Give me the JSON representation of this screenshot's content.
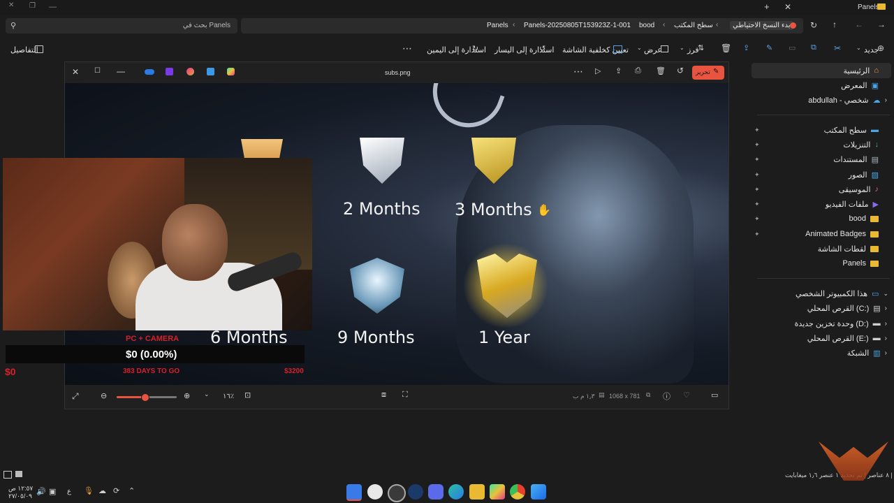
{
  "titlebar": {
    "app_label": "Panels"
  },
  "address": {
    "search_placeholder": "بحث في Panels",
    "breadcrumbs": [
      "Panels",
      "Panels-20250805T153923Z-1-001",
      "bood",
      "سطح المكتب",
      "بدء النسخ الاحتياطي"
    ]
  },
  "command_bar": {
    "details": "التفاصيل",
    "new": "جديد",
    "sort": "فرز",
    "view": "عرض",
    "set_wallpaper": "تعيين كخلفية الشاشة",
    "rotate_left": "استدارة إلى اليسار",
    "rotate_right": "استدارة إلى اليمين"
  },
  "sidebar": {
    "home": "الرئيسية",
    "gallery": "المعرض",
    "onedrive": "abdullah - شخصي",
    "pinned": [
      "سطح المكتب",
      "التنزيلات",
      "المستندات",
      "الصور",
      "الموسيقى",
      "ملفات الفيديو",
      "bood",
      "Animated Badges",
      "لقطات الشاشة",
      "Panels"
    ],
    "this_pc": "هذا الكمبيوتر الشخصي",
    "drives": [
      "القرص المحلي (C:)",
      "وحدة تخزين جديدة (D:)",
      "القرص المحلي (E:)"
    ],
    "network": "الشبكة"
  },
  "viewer": {
    "filename": "subs.png",
    "edit_label": "تحرير",
    "badges": [
      "2 Months",
      "3 Months",
      "6 Months",
      "9 Months",
      "1 Year"
    ],
    "zoom": "١٦٪",
    "dimensions": "1068 x 781",
    "filesize": "١٫٣ م ب",
    "zoom_level": 0.46
  },
  "stream": {
    "mode": "PC + CAMERA",
    "amount": "$0 (0.00%)",
    "days": "383 DAYS TO GO",
    "goal": "$3200",
    "start": "$0"
  },
  "statusbar": {
    "text": "٨ عناصر | تم تحديد ١ عنصر ١٫٦ ميغابايت |"
  },
  "taskbar": {
    "time": "١٢:٥٧ ص",
    "date": "٢٧/٠٥/٠٩",
    "lang": "ع"
  },
  "colors": {
    "accent_red": "#e8543f",
    "gold": "#e8c23a",
    "stream_red": "#d8202a"
  }
}
